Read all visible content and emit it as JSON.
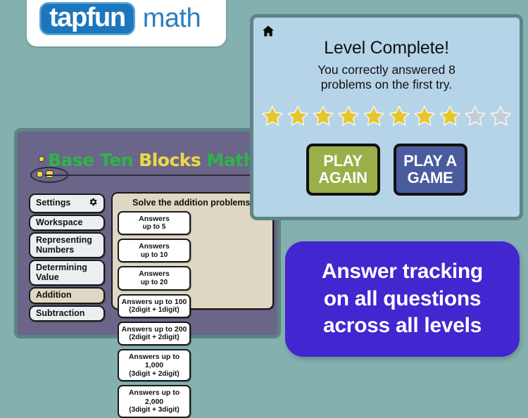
{
  "brand": {
    "logo_box_text": "tapfun",
    "logo_suffix": "math",
    "logo_box_color": "#1b76bd",
    "logo_text_color": "#2a7fc0"
  },
  "app": {
    "title_part1": "Base Ten ",
    "title_part2": "Blocks",
    "title_part3": " Math",
    "title_green": "#2fb34a",
    "title_yellow": "#e8d84a",
    "panel_color": "#6b6589",
    "menu": [
      {
        "label": "Settings",
        "icon": "gear-icon",
        "active": false
      },
      {
        "label": "Workspace",
        "active": false
      },
      {
        "label": "Representing\nNumbers",
        "line1": "Representing",
        "line2": "Numbers",
        "active": false
      },
      {
        "label": "Determining\nValue",
        "line1": "Determining",
        "line2": "Value",
        "active": false
      },
      {
        "label": "Addition",
        "active": true
      },
      {
        "label": "Subtraction",
        "active": false
      }
    ],
    "content": {
      "heading": "Solve the addition problems.",
      "levels": [
        {
          "line1": "Answers",
          "line2": "up to 5"
        },
        {
          "line1": "Answers",
          "line2": "up to 10"
        },
        {
          "line1": "Answers",
          "line2": "up to 20"
        },
        {
          "line1": "Answers up to 100",
          "line2": "(2digit + 1digit)"
        },
        {
          "line1": "Answers up to 200",
          "line2": "(2digit + 2digit)"
        },
        {
          "line1": "Answers up to 1,000",
          "line2": "(3digit + 2digit)"
        },
        {
          "line1": "Answers up to 2,000",
          "line2": "(3digit + 3digit)"
        }
      ]
    }
  },
  "dialog": {
    "home_icon": "home-icon",
    "title": "Level Complete!",
    "subtitle_line1": "You correctly answered 8",
    "subtitle_line2": "problems on the first try.",
    "stars_filled": 8,
    "stars_total": 10,
    "star_filled_color": "#e8c62a",
    "star_empty_color": "#c4cdd4",
    "buttons": [
      {
        "line1": "PLAY",
        "line2": "AGAIN",
        "color": "#9aae4a"
      },
      {
        "line1": "PLAY A",
        "line2": "GAME",
        "color": "#4a5b9e"
      }
    ],
    "bg_color": "#b6d4e8"
  },
  "promo": {
    "line1": "Answer tracking",
    "line2": "on all questions",
    "line3": "across all levels",
    "bg_color": "#4226cf"
  },
  "page": {
    "background": "#84b0b0"
  }
}
